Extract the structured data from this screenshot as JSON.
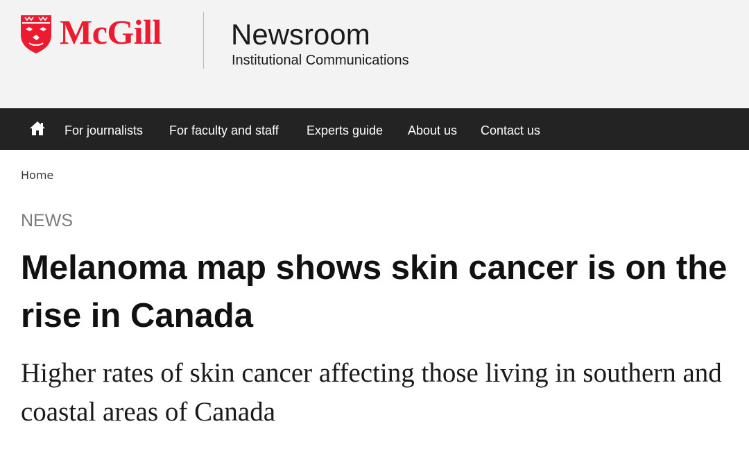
{
  "header": {
    "logo_text": "McGill",
    "site_title": "Newsroom",
    "site_subtitle": "Institutional Communications",
    "logo_icon": "mcgill-crest-icon",
    "brand_color": "#ed1b2f"
  },
  "nav": {
    "home_icon": "home-icon",
    "items": [
      {
        "label": "For journalists"
      },
      {
        "label": "For faculty and staff"
      },
      {
        "label": "Experts guide"
      },
      {
        "label": "About us"
      },
      {
        "label": "Contact us"
      }
    ]
  },
  "breadcrumb": {
    "home": "Home"
  },
  "article": {
    "category": "NEWS",
    "headline": "Melanoma map shows skin cancer is on the rise in Canada",
    "subheadline": "Higher rates of skin cancer affecting those living in southern and coastal areas of Canada"
  }
}
